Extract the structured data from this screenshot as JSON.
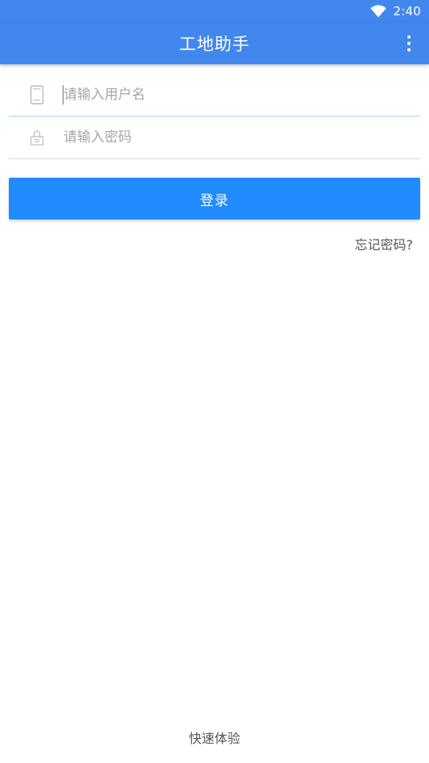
{
  "status_bar": {
    "time": "2:40",
    "icon": "wifi-icon"
  },
  "app_bar": {
    "title": "工地助手",
    "menu_icon": "more-vert-icon"
  },
  "login_form": {
    "username": {
      "placeholder": "请输入用户名",
      "value": "",
      "icon": "phone-icon"
    },
    "password": {
      "placeholder": "请输入密码",
      "value": "",
      "icon": "lock-icon"
    },
    "login_label": "登录",
    "forgot_label": "忘记密码?"
  },
  "footer": {
    "quick_try_label": "快速体验"
  },
  "colors": {
    "primary": "#4287ee",
    "button": "#218bff",
    "focus_underline": "#a9d2f3",
    "divider": "#d8d8d8",
    "placeholder": "#a6a6a6",
    "secondary_text": "#555555"
  }
}
